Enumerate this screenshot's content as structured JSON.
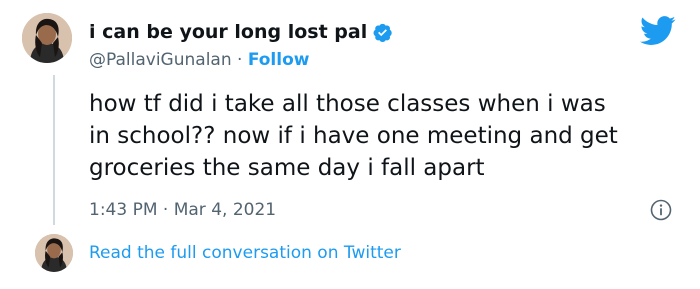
{
  "colors": {
    "accent": "#1d9bf0",
    "text_primary": "#0f1419",
    "text_secondary": "#536471"
  },
  "author": {
    "display_name": "i can be your long lost pal",
    "handle": "@PallaviGunalan",
    "separator": "·",
    "follow_label": "Follow",
    "verified": true
  },
  "icons": {
    "brand": "twitter-bird-icon",
    "verified": "verified-badge-icon",
    "info": "info-icon"
  },
  "tweet": {
    "text_lines": [
      "how tf did i take all those classes when i was",
      "in school?? now if i have one meeting and get",
      "groceries the same day i fall apart"
    ],
    "time": "1:43 PM",
    "separator": "·",
    "date": "Mar 4, 2021"
  },
  "footer": {
    "link_label": "Read the full conversation on Twitter"
  }
}
